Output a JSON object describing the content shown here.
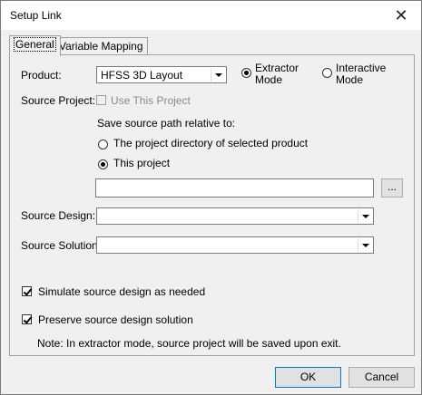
{
  "window": {
    "title": "Setup Link"
  },
  "tabs": [
    {
      "label": "General"
    },
    {
      "label": "Variable Mapping"
    }
  ],
  "general": {
    "product_label": "Product:",
    "product_value": "HFSS 3D Layout",
    "extractor_mode": "Extractor Mode",
    "extractor_mode_line1": "Extractor",
    "extractor_mode_line2": "Mode",
    "interactive_mode_line1": "Interactive",
    "interactive_mode_line2": "Mode",
    "source_project_label": "Source Project:",
    "use_this_project": "Use This Project",
    "save_relative_label": "Save source path relative to:",
    "option_project_dir": "The project directory of selected product",
    "option_this_project": "This project",
    "path_value": "",
    "browse_label": "...",
    "source_design_label": "Source Design:",
    "source_design_value": "",
    "source_solution_label": "Source Solution:",
    "source_solution_value": "",
    "simulate_label": "Simulate source design as needed",
    "preserve_label": "Preserve source design solution",
    "note": "Note: In extractor mode, source project will be saved upon exit."
  },
  "footer": {
    "ok_label": "OK",
    "cancel_label": "Cancel"
  }
}
